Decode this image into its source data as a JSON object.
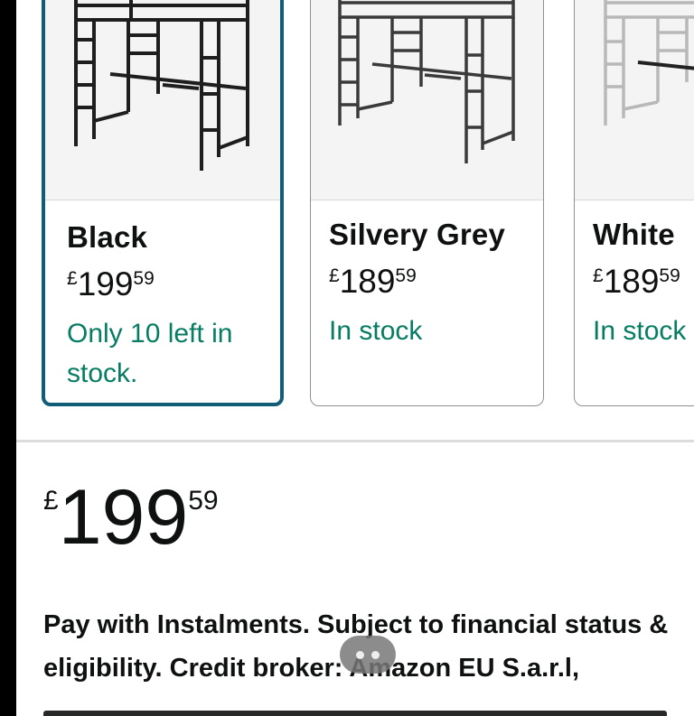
{
  "variants": [
    {
      "name": "Black",
      "currency": "£",
      "price_whole": "199",
      "price_fraction": "59",
      "stock": "Only 10 left in stock.",
      "selected": true
    },
    {
      "name": "Silvery Grey",
      "currency": "£",
      "price_whole": "189",
      "price_fraction": "59",
      "stock": "In stock",
      "selected": false
    },
    {
      "name": "White",
      "currency": "£",
      "price_whole": "189",
      "price_fraction": "59",
      "stock": "In stock",
      "selected": false
    }
  ],
  "main_price": {
    "currency": "£",
    "whole": "199",
    "fraction": "59"
  },
  "instalments_text": "Pay with Instalments. Subject to financial status & eligibility. Credit broker: Amazon EU S.a.r.l,",
  "colors": {
    "selected_border": "#0f5d76",
    "in_stock": "#067d62",
    "text": "#0f1111"
  },
  "icons": {
    "bed_image": "loft-bed-image",
    "drag_handle": "drag-handle-icon"
  }
}
